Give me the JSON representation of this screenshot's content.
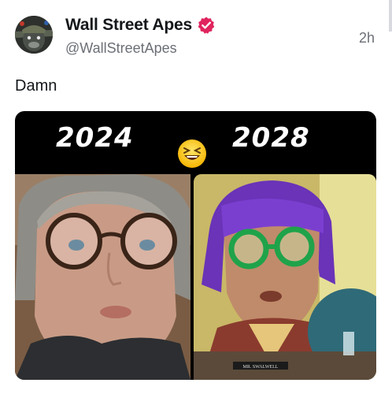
{
  "post": {
    "display_name": "Wall Street Apes",
    "handle": "@WallStreetApes",
    "time": "2h",
    "text": "Damn"
  },
  "media": {
    "left_year": "2024",
    "right_year": "2028",
    "nameplate": "MR. SWALWELL",
    "emoji": "grinning-squinting-face"
  },
  "colors": {
    "verified_badge": "#e0245e",
    "text_primary": "#14171a",
    "text_secondary": "#6b6f76"
  }
}
